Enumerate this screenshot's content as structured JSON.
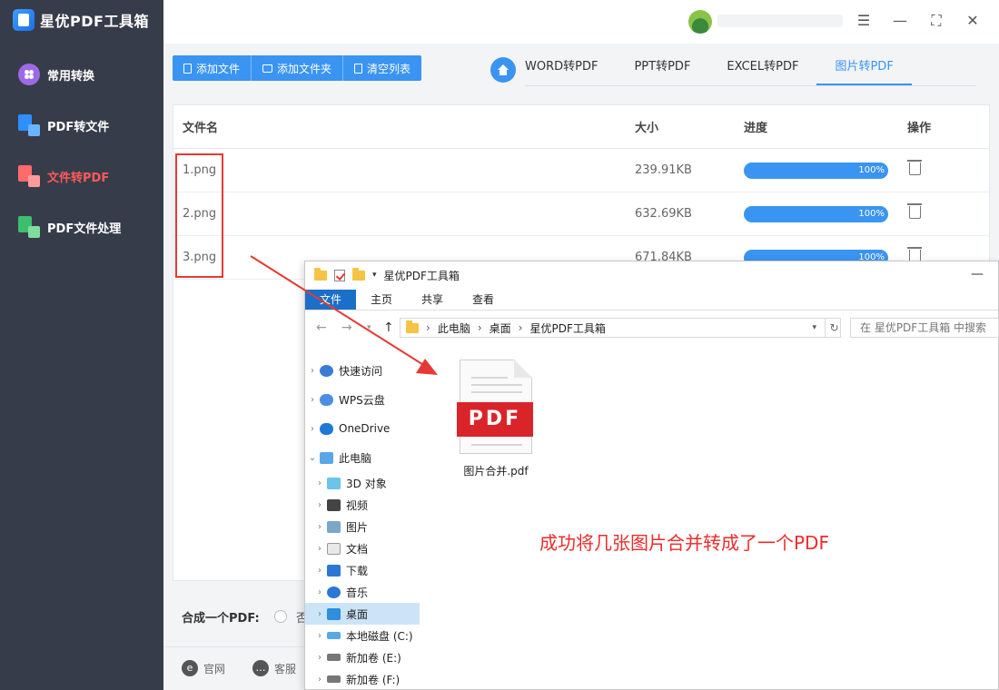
{
  "app": {
    "title": "星优PDF工具箱",
    "accent": "#3a94f2",
    "active_nav_color": "#ff5a5a"
  },
  "sidebar": {
    "items": [
      {
        "label": "常用转换",
        "icon": "grid-circle-icon"
      },
      {
        "label": "PDF转文件",
        "icon": "pdf-to-file-icon"
      },
      {
        "label": "文件转PDF",
        "icon": "file-to-pdf-icon",
        "active": true
      },
      {
        "label": "PDF文件处理",
        "icon": "pdf-process-icon"
      }
    ]
  },
  "toolbar": {
    "add_file": "添加文件",
    "add_folder": "添加文件夹",
    "clear_list": "清空列表"
  },
  "tabs": [
    "WORD转PDF",
    "PPT转PDF",
    "EXCEL转PDF",
    "图片转PDF"
  ],
  "active_tab": "图片转PDF",
  "table": {
    "headers": {
      "name": "文件名",
      "size": "大小",
      "progress": "进度",
      "action": "操作"
    },
    "rows": [
      {
        "name": "1.png",
        "size": "239.91KB",
        "progress": "100%"
      },
      {
        "name": "2.png",
        "size": "632.69KB",
        "progress": "100%"
      },
      {
        "name": "3.png",
        "size": "671.84KB",
        "progress": "100%"
      }
    ]
  },
  "merge": {
    "label": "合成一个PDF:",
    "option_no": "否"
  },
  "footer": {
    "website": "官网",
    "service": "客服"
  },
  "explorer": {
    "title": "星优PDF工具箱",
    "ribbon": [
      "文件",
      "主页",
      "共享",
      "查看"
    ],
    "address": [
      "此电脑",
      "桌面",
      "星优PDF工具箱"
    ],
    "search_placeholder": "在 星优PDF工具箱 中搜索",
    "tree_top": [
      "快速访问",
      "WPS云盘",
      "OneDrive",
      "此电脑"
    ],
    "tree_children": [
      "3D 对象",
      "视频",
      "图片",
      "文档",
      "下载",
      "音乐",
      "桌面",
      "本地磁盘 (C:)",
      "新加卷 (E:)",
      "新加卷 (F:)"
    ],
    "selected": "桌面",
    "file_name": "图片合并.pdf",
    "pdf_badge": "PDF"
  },
  "annotation": {
    "caption": "成功将几张图片合并转成了一个PDF",
    "color": "#ee2b2b"
  }
}
